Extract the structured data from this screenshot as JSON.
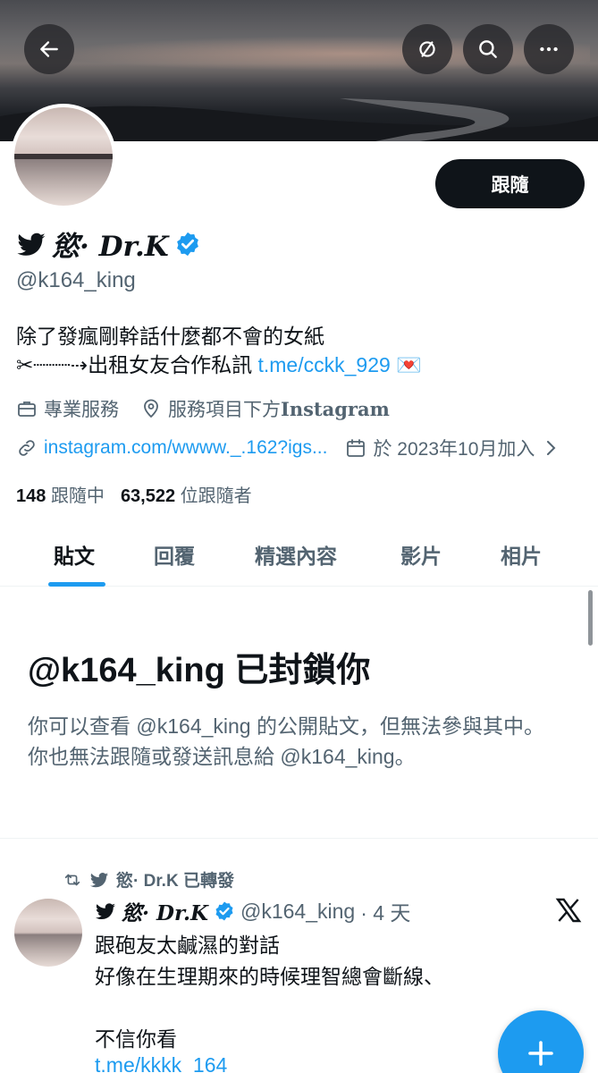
{
  "header": {
    "back_icon": "arrow-left-icon",
    "actions": [
      "unfollow-icon",
      "search-icon",
      "more-icon"
    ]
  },
  "profile": {
    "name": "🐦慾· 𝓓𝓻.𝓚",
    "name_text": "慾· Dr.K",
    "handle": "@k164_king",
    "follow_label": "跟隨",
    "bio_line1": "除了發瘋剛幹話什麼都不會的女紙",
    "bio_line2_prefix": "✂┈┈┈⇢出租女友合作私訊 ",
    "bio_link": "t.me/cckk_929",
    "bio_emoji": "💌",
    "category": "專業服務",
    "location_prefix": "服務項目下方",
    "location_ig": "Instagram",
    "website": "instagram.com/wwww._.162?igs...",
    "joined": "於 2023年10月加入",
    "following_count": "148",
    "following_label": "跟隨中",
    "followers_count": "63,522",
    "followers_label": "位跟隨者"
  },
  "tabs": [
    {
      "label": "貼文",
      "active": true
    },
    {
      "label": "回覆"
    },
    {
      "label": "精選內容"
    },
    {
      "label": "影片"
    },
    {
      "label": "相片"
    }
  ],
  "blocked": {
    "title": "@k164_king 已封鎖你",
    "description": "你可以查看 @k164_king 的公開貼文，但無法參與其中。你也無法跟隨或發送訊息給 @k164_king。"
  },
  "tweet": {
    "retweet_label": "慾· Dr.K 已轉發",
    "author_name": "慾· Dr.K",
    "author_handle": "@k164_king",
    "time": "· 4 天",
    "text": "跟砲友太鹹濕的對話\n好像在生理期來的時候理智總會斷線、\n\n不信你看",
    "link": "t.me/kkkk_164"
  },
  "colors": {
    "accent": "#1d9bf0",
    "text": "#0f1419",
    "muted": "#536471"
  }
}
